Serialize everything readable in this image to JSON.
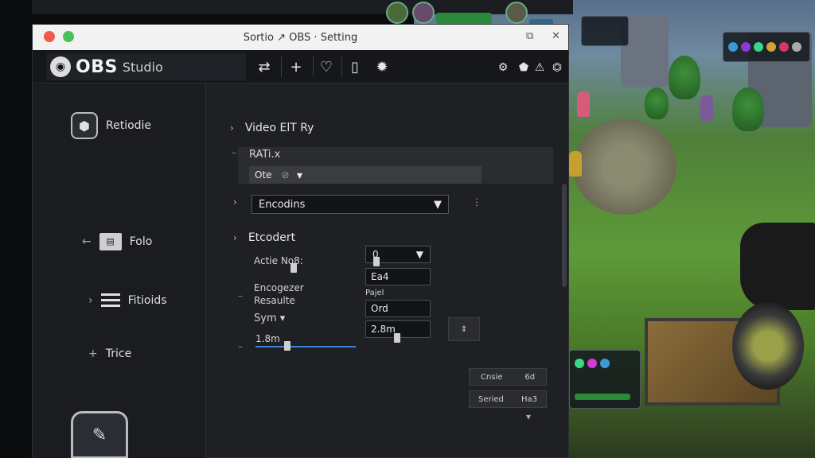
{
  "window": {
    "title": "Sortio ↗ OBS · Setting",
    "maximize_icon": "⧉",
    "close_icon": "✕"
  },
  "appbar": {
    "logo_obs": "OBS",
    "logo_studio": "Studio",
    "toolbar_icons": [
      "scene-switch-icon",
      "plus-icon",
      "chat-icon",
      "clipboard-icon",
      "settings-gear-icon"
    ],
    "right_icons": [
      "gear-icon",
      "pentagon-icon",
      "warning-icon",
      "clock-icon"
    ]
  },
  "sidebar": {
    "items": [
      {
        "label": "Retiodie"
      },
      {
        "label": "Folo"
      },
      {
        "label": "Fitioids"
      },
      {
        "label": "Trice"
      }
    ]
  },
  "main": {
    "video_heading": "Video ElT Ry",
    "ratio_label": "RATi.x",
    "ote_field": "Ote",
    "ote_suffix": "⊘",
    "encoding_select": "Encodins",
    "encoder_heading": "Etcodert",
    "active_label": "Actie No8:",
    "encoder_label": "Encogezer",
    "resolution_label": "Resaulte",
    "sym_label": "Sym",
    "slider_value": "1.8m",
    "select_value": "0",
    "field_ea": "Ea4",
    "rate_label": "Pajel",
    "field_ord": "Ord",
    "field_rate": "2.8m",
    "mini_btns": [
      {
        "a": "Cnsie",
        "b": "6d"
      },
      {
        "a": "Seried",
        "b": "Ha3"
      }
    ]
  },
  "colors": {
    "accent": "#3b82d6",
    "panel": "#1e2024",
    "title": "#f2f2f2"
  }
}
